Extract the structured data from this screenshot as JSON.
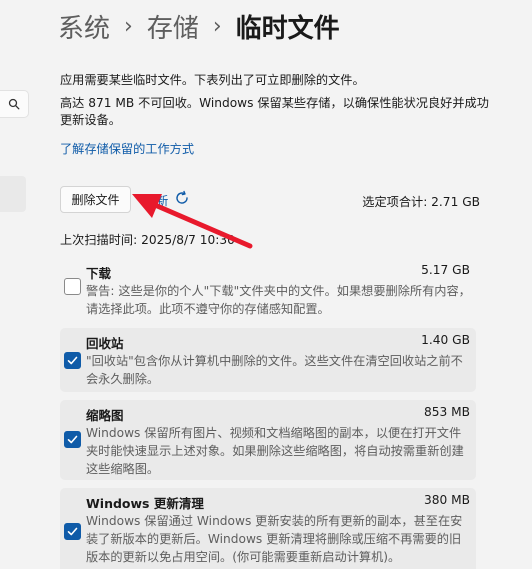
{
  "breadcrumb": {
    "item1": "系统",
    "item2": "存储",
    "current": "临时文件",
    "separator": "›"
  },
  "description": {
    "line1": "应用需要某些临时文件。下表列出了可立即删除的文件。",
    "line2": "高达 871 MB 不可回收。Windows 保留某些存储，以确保性能状况良好并成功更新设备。"
  },
  "learn_more_link": "了解存储保留的工作方式",
  "actions": {
    "delete_label": "删除文件",
    "refresh_label": "刷新"
  },
  "selected_total": "选定项合计: 2.71 GB",
  "last_scan": "上次扫描时间: 2025/8/7 10:30",
  "items": [
    {
      "name": "下载",
      "size": "5.17 GB",
      "checked": false,
      "description": "警告: 这些是你的个人\"下载\"文件夹中的文件。如果想要删除所有内容，请选择此项。此项不遵守你的存储感知配置。"
    },
    {
      "name": "回收站",
      "size": "1.40 GB",
      "checked": true,
      "description": "\"回收站\"包含你从计算机中删除的文件。这些文件在清空回收站之前不会永久删除。"
    },
    {
      "name": "缩略图",
      "size": "853 MB",
      "checked": true,
      "description": "Windows 保留所有图片、视频和文档缩略图的副本，以便在打开文件夹时能快速显示上述对象。如果删除这些缩略图，将自动按需重新创建这些缩略图。"
    },
    {
      "name": "Windows 更新清理",
      "size": "380 MB",
      "checked": true,
      "description": "Windows 保留通过 Windows 更新安装的所有更新的副本，甚至在安装了新版本的更新后。Windows 更新清理将删除或压缩不再需要的旧版本的更新以免占用空间。(你可能需要重新启动计算机)。"
    }
  ],
  "icons": {
    "search": "search-icon",
    "refresh": "refresh-icon",
    "check": "checkmark-icon"
  },
  "colors": {
    "accent": "#0f5ba8",
    "annotation_arrow": "#e8192c",
    "background": "#f3f3f3",
    "selected_card": "#eaeaea"
  }
}
